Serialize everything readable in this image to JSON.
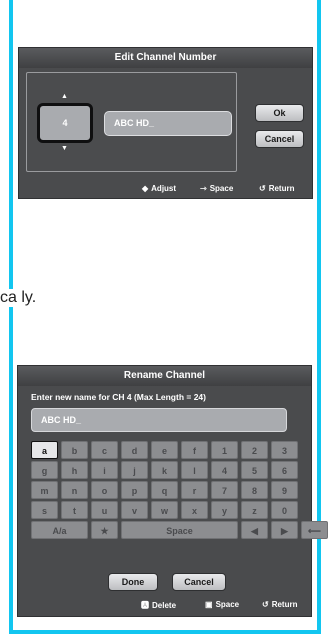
{
  "edit_dialog": {
    "title": "Edit Channel Number",
    "channel_number": "4",
    "channel_name": "ABC HD_",
    "ok_label": "Ok",
    "cancel_label": "Cancel",
    "footer": {
      "adjust": "Adjust",
      "space": "Space",
      "return": "Return"
    }
  },
  "page_text": {
    "fragment": "ca ly."
  },
  "rename_dialog": {
    "title": "Rename Channel",
    "prompt": "Enter new name for CH 4 (Max Length = 24)",
    "name_value": "ABC HD_",
    "keyboard_rows": [
      [
        "a",
        "b",
        "c",
        "d",
        "e",
        "f",
        "1",
        "2",
        "3"
      ],
      [
        "g",
        "h",
        "i",
        "j",
        "k",
        "l",
        "4",
        "5",
        "6"
      ],
      [
        "m",
        "n",
        "o",
        "p",
        "q",
        "r",
        "7",
        "8",
        "9"
      ],
      [
        "s",
        "t",
        "u",
        "v",
        "w",
        "x",
        "y",
        "z",
        "0"
      ]
    ],
    "special_keys": {
      "case": "A/a",
      "star": "★",
      "space": "Space",
      "left": "◀",
      "right": "▶",
      "backspace": "⟵"
    },
    "done_label": "Done",
    "cancel_label": "Cancel",
    "footer": {
      "delete": "Delete",
      "space": "Space",
      "return": "Return"
    },
    "selected_key": "a"
  },
  "colors": {
    "frame_border": "#12c6f0",
    "dialog_bg": "#4a4b4d"
  }
}
